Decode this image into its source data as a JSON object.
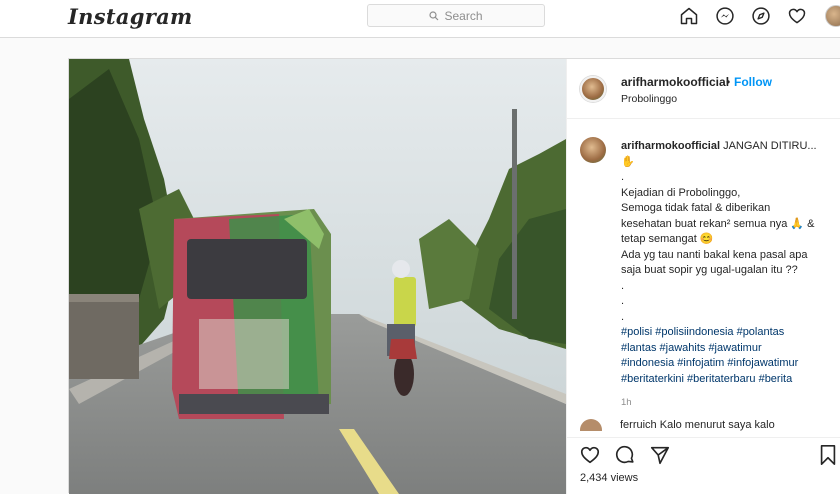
{
  "app": {
    "logo": "Instagram"
  },
  "search": {
    "placeholder": "Search"
  },
  "nav": {
    "icons": [
      "home-icon",
      "messenger-icon",
      "explore-icon",
      "heart-icon",
      "profile-avatar"
    ]
  },
  "post": {
    "username": "arifharmokoofficial",
    "dot": "•",
    "follow_label": "Follow",
    "location": "Probolinggo",
    "caption": {
      "username": "arifharmokoofficial",
      "first_line": "JANGAN DITIRU...",
      "lines": [
        "✋",
        ".",
        "Kejadian di Probolinggo,",
        "Semoga tidak fatal & diberikan",
        "kesehatan buat rekan² semua nya 🙏 &",
        "tetap semangat 😊",
        "Ada yg tau nanti bakal kena pasal apa",
        "saja buat sopir yg ugal-ugalan itu ??",
        ".",
        ".",
        "."
      ],
      "hashtags": [
        "#polisi #polisiindonesia #polantas",
        "#lantas #jawahits #jawatimur",
        "#indonesia #infojatim #infojawatimur",
        "#beritaterkini #beritaterbaru #berita"
      ],
      "time": "1h"
    },
    "next_comment": "ferruich Kalo menurut saya kalo",
    "views": "2,434 views"
  }
}
